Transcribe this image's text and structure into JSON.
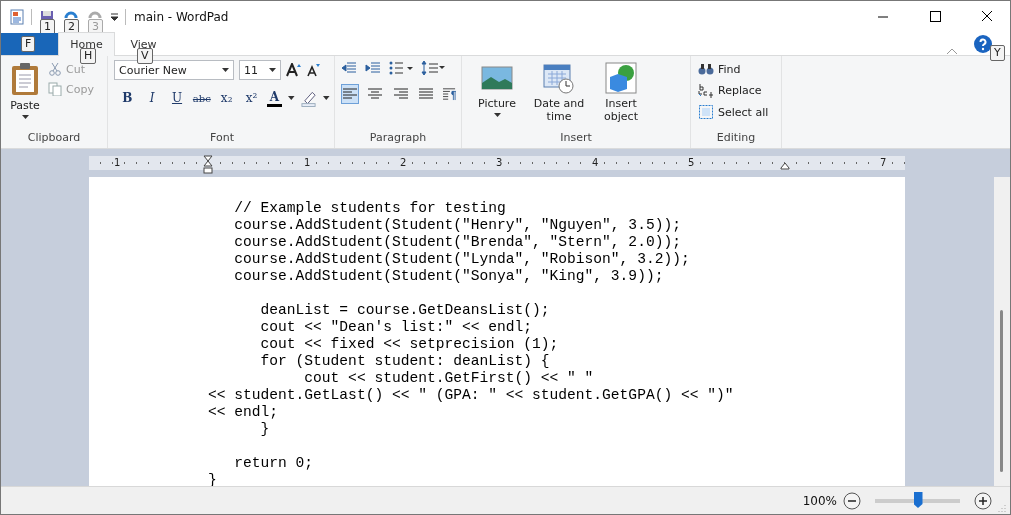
{
  "window": {
    "title": "main - WordPad",
    "quick_access_keytips": [
      "1",
      "2",
      "3"
    ]
  },
  "tabs": [
    {
      "keytip": "F",
      "kind": "file",
      "selected": false
    },
    {
      "label": "Home",
      "keytip": "H",
      "kind": "tab",
      "selected": true
    },
    {
      "label": "View",
      "keytip": "V",
      "kind": "tab",
      "selected": false
    }
  ],
  "help_keytip": "Y",
  "ribbon": {
    "clipboard": {
      "label": "Clipboard",
      "paste": "Paste",
      "cut": {
        "label": "Cut",
        "disabled": true
      },
      "copy": {
        "label": "Copy",
        "disabled": true
      }
    },
    "font": {
      "label": "Font",
      "family": "Courier New",
      "size": "11",
      "styles": [
        "B",
        "I",
        "U",
        "abc",
        "x₂",
        "x²"
      ],
      "color_glyph": "A"
    },
    "paragraph": {
      "label": "Paragraph",
      "alignments": [
        {
          "kind": "left",
          "selected": true
        },
        {
          "kind": "center",
          "selected": false
        },
        {
          "kind": "right",
          "selected": false
        },
        {
          "kind": "justify",
          "selected": false
        }
      ]
    },
    "insert": {
      "label": "Insert",
      "items": [
        {
          "kind": "picture",
          "label": "Picture"
        },
        {
          "kind": "datetime",
          "label": "Date and time"
        },
        {
          "kind": "object",
          "label": "Insert object"
        }
      ]
    },
    "editing": {
      "label": "Editing",
      "items": [
        {
          "kind": "find",
          "label": "Find"
        },
        {
          "kind": "replace",
          "label": "Replace"
        },
        {
          "kind": "select",
          "label": "Select all"
        }
      ]
    }
  },
  "ruler": [
    "1",
    "1",
    "2",
    "3",
    "4",
    "5",
    "7"
  ],
  "document": {
    "blocks": [
      [
        "   // Example students for testing",
        "   course.AddStudent(Student(\"Henry\", \"Nguyen\", 3.5));",
        "   course.AddStudent(Student(\"Brenda\", \"Stern\", 2.0));",
        "   course.AddStudent(Student(\"Lynda\", \"Robison\", 3.2));",
        "   course.AddStudent(Student(\"Sonya\", \"King\", 3.9));"
      ],
      [
        "      deanList = course.GetDeansList();",
        "      cout << \"Dean's list:\" << endl;",
        "      cout << fixed << setprecision (1);",
        "      for (Student student: deanList) {",
        "           cout << student.GetFirst() << \" \"",
        "<< student.GetLast() << \" (GPA: \" << student.GetGPA() << \")\"",
        "<< endl;",
        "      }"
      ],
      [
        "   return 0;",
        "}"
      ]
    ]
  },
  "status_bar": {
    "zoom": "100%",
    "level": 0.5
  }
}
